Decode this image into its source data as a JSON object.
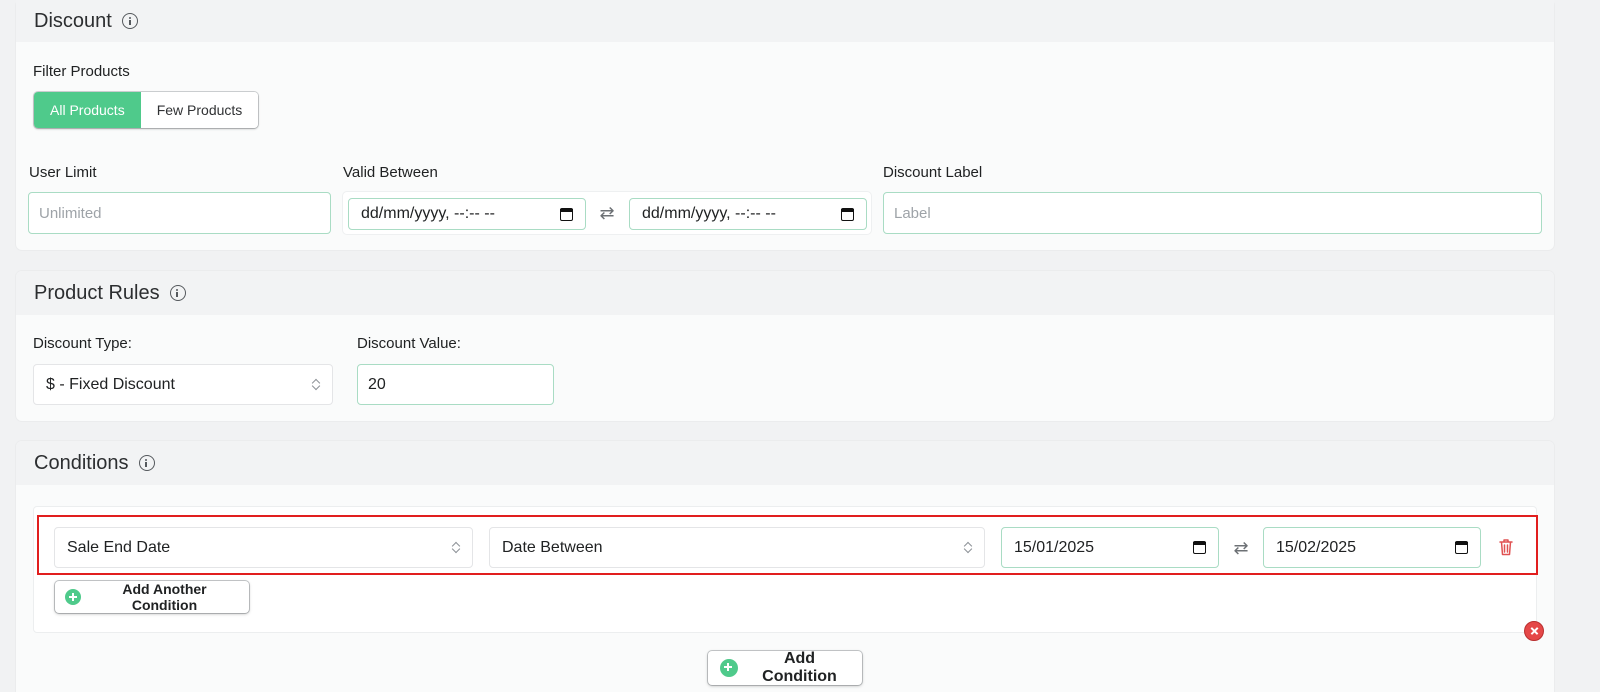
{
  "discount": {
    "title": "Discount",
    "filter_label": "Filter Products",
    "filter_options": [
      "All Products",
      "Few Products"
    ],
    "filter_selected": "All Products",
    "user_limit": {
      "label": "User Limit",
      "placeholder": "Unlimited",
      "value": ""
    },
    "valid_between": {
      "label": "Valid Between",
      "start": "dd/mm/yyyy, --:-- --",
      "end": "dd/mm/yyyy, --:-- --"
    },
    "discount_label": {
      "label": "Discount Label",
      "placeholder": "Label",
      "value": ""
    }
  },
  "product_rules": {
    "title": "Product Rules",
    "discount_type": {
      "label": "Discount Type:",
      "value": "$ - Fixed Discount"
    },
    "discount_value": {
      "label": "Discount Value:",
      "value": "20"
    }
  },
  "conditions": {
    "title": "Conditions",
    "rows": [
      {
        "field": "Sale End Date",
        "operator": "Date Between",
        "start": "15/01/2025",
        "end": "15/02/2025"
      }
    ],
    "add_another_label": "Add Another Condition",
    "add_condition_label": "Add Condition"
  },
  "colors": {
    "accent": "#4fca8b",
    "input_border": "#a9dcc4",
    "danger": "#e11e1e"
  }
}
